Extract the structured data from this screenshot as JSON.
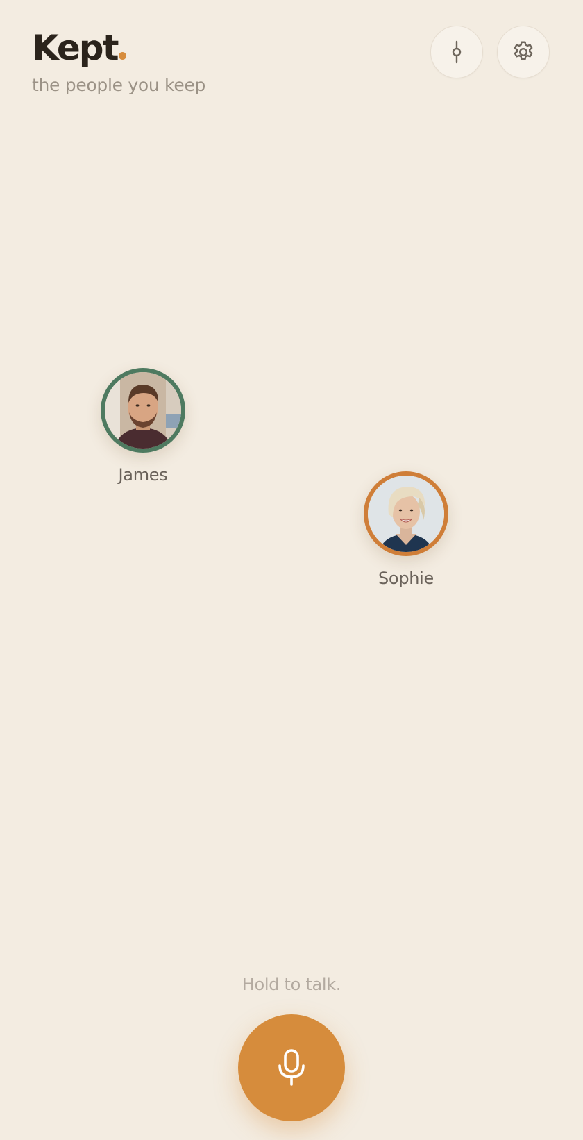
{
  "app": {
    "title": "Kept",
    "subtitle": "the people you keep",
    "accent_color": "#d68c3c"
  },
  "header": {
    "timeline_icon": "timeline-icon",
    "settings_icon": "gear-icon"
  },
  "people": [
    {
      "name": "James",
      "ring_color": "#4e7a60"
    },
    {
      "name": "Sophie",
      "ring_color": "#cf7e38"
    }
  ],
  "footer": {
    "hint": "Hold to talk.",
    "mic_icon": "microphone-icon"
  }
}
